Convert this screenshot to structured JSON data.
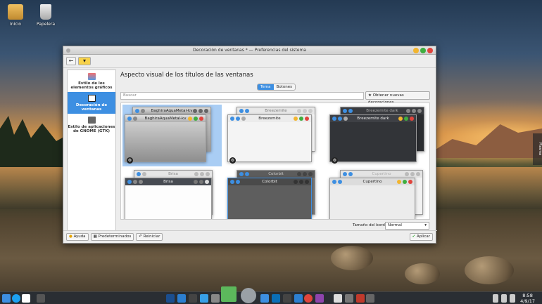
{
  "desktop": {
    "icons": [
      {
        "label": "Inicio",
        "icon": "home-folder-icon"
      },
      {
        "label": "Papelera",
        "icon": "trash-icon"
      }
    ]
  },
  "window": {
    "title": "Decoración de ventanas * — Preferencias del sistema"
  },
  "sidebar": {
    "items": [
      {
        "label": "Estilo de los elementos gráficos",
        "icon": "widget-style-icon"
      },
      {
        "label": "Decoración de ventanas",
        "icon": "window-decoration-icon"
      },
      {
        "label": "Estilo de aplicaciones de GNOME (GTK)",
        "icon": "gtk-icon"
      }
    ]
  },
  "main": {
    "heading": "Aspecto visual de los títulos de las ventanas",
    "tabs": [
      "Tema",
      "Botones"
    ],
    "search_placeholder": "Buscar",
    "get_new": "Obtener nuevas decoraciones..."
  },
  "themes": [
    {
      "back": "BaghiraAquaMetal-kv",
      "front": "BaghiraAquaMetal-kv"
    },
    {
      "back": "Breezemite",
      "front": "Breezemite"
    },
    {
      "back": "Breezemite dark",
      "front": "Breezemite dark"
    },
    {
      "back": "Brisa",
      "front": "Brisa"
    },
    {
      "back": "Colorbit",
      "front": "Colorbit"
    },
    {
      "back": "Cupertino",
      "front": "Cupertino"
    }
  ],
  "footer": {
    "border_label": "Tamaño del borde:",
    "border_value": "Normal",
    "help": "Ayuda",
    "defaults": "Predeterminados",
    "reset": "Reiniciar",
    "apply": "Aplicar"
  },
  "panel": {
    "time": "8:58",
    "date": "4/9/17"
  },
  "side_widget": {
    "label": "Plasma"
  },
  "colors": {
    "accent": "#3d8fe2",
    "close": "#e0443c",
    "minimize": "#f2b52f",
    "maximize": "#3fae3f"
  }
}
